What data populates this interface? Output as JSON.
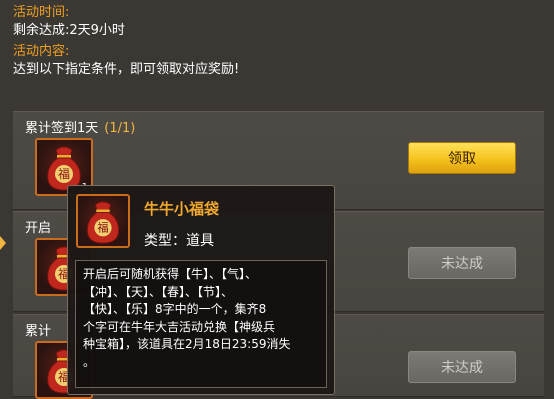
{
  "activity": {
    "time_label": "活动时间:",
    "time_value": "剩余达成:2天9小时",
    "content_label": "活动内容:",
    "content_value": "达到以下指定条件，即可领取对应奖励!"
  },
  "tasks": [
    {
      "title": "累计签到1天",
      "progress": "(1/1)",
      "reward_count": "1",
      "button": "领取",
      "button_state": "claimable"
    },
    {
      "title": "开启",
      "progress": "",
      "reward_count": "",
      "button": "未达成",
      "button_state": "disabled"
    },
    {
      "title": "累计",
      "progress": "",
      "reward_count": "",
      "button": "未达成",
      "button_state": "disabled"
    }
  ],
  "tooltip": {
    "item_name": "牛牛小福袋",
    "item_type": "类型：道具",
    "description": "开启后可随机获得【牛】、【气】、\n【冲】、【天】、【春】、【节】、\n【快】、【乐】8字中的一个，集齐8\n个字可在牛年大吉活动兑换【神级兵\n种宝箱】，该道具在2月18日23:59消失\n。",
    "bag_char": "福"
  },
  "colors": {
    "label_orange": "#f0a020",
    "claim_yellow": "#f4c21d",
    "slot_border": "#c96d1c",
    "bag_red": "#c0281e"
  }
}
